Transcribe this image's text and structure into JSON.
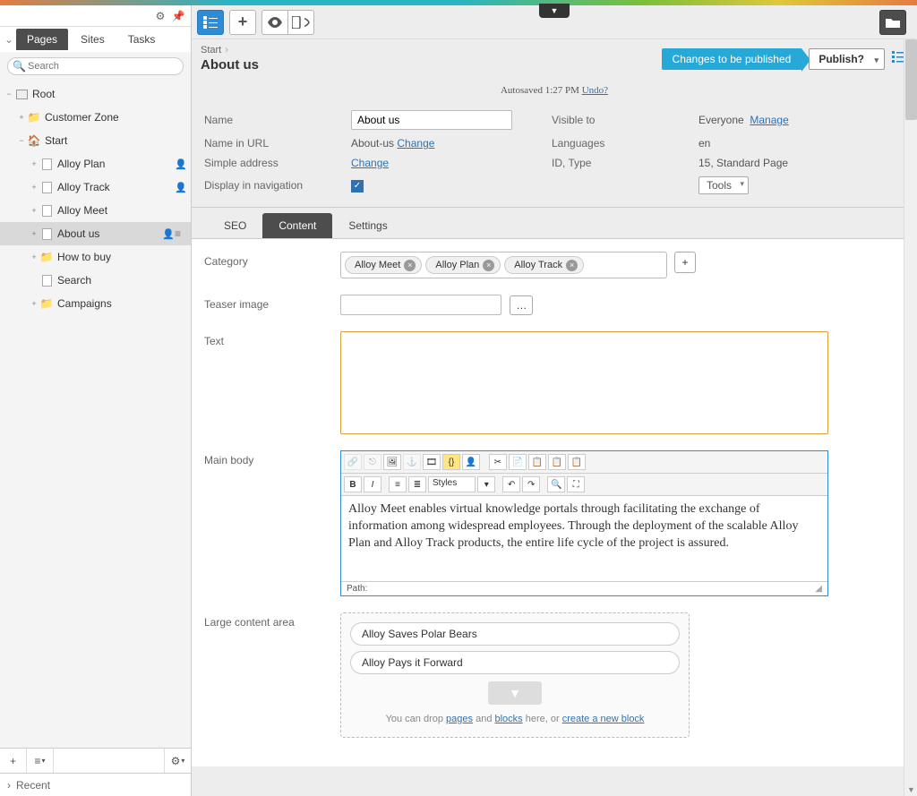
{
  "left": {
    "tabs": [
      "Pages",
      "Sites",
      "Tasks"
    ],
    "search_placeholder": "Search",
    "root": "Root",
    "nodes": [
      {
        "label": "Customer Zone",
        "depth": 1,
        "icon": "folder",
        "expand": "+"
      },
      {
        "label": "Start",
        "depth": 1,
        "icon": "home",
        "expand": "−"
      },
      {
        "label": "Alloy Plan",
        "depth": 2,
        "icon": "file",
        "expand": "+",
        "user": true
      },
      {
        "label": "Alloy Track",
        "depth": 2,
        "icon": "file",
        "expand": "+",
        "user": true
      },
      {
        "label": "Alloy Meet",
        "depth": 2,
        "icon": "file",
        "expand": "+"
      },
      {
        "label": "About us",
        "depth": 2,
        "icon": "file",
        "expand": "+",
        "selected": true,
        "user": true,
        "menu": true
      },
      {
        "label": "How to buy",
        "depth": 2,
        "icon": "folder",
        "expand": "+"
      },
      {
        "label": "Search",
        "depth": 2,
        "icon": "file",
        "expand": ""
      },
      {
        "label": "Campaigns",
        "depth": 2,
        "icon": "folder",
        "expand": "+"
      }
    ],
    "recent": "Recent"
  },
  "header": {
    "breadcrumb": "Start",
    "title": "About us",
    "status": "Changes to be published",
    "publish": "Publish?",
    "autosave_prefix": "Autosaved 1:27 PM",
    "undo": "Undo?"
  },
  "props": {
    "name_lbl": "Name",
    "name_val": "About us",
    "url_lbl": "Name in URL",
    "url_val": "About-us",
    "change": "Change",
    "simple_lbl": "Simple address",
    "nav_lbl": "Display in navigation",
    "visible_lbl": "Visible to",
    "visible_val": "Everyone",
    "manage": "Manage",
    "lang_lbl": "Languages",
    "lang_val": "en",
    "id_lbl": "ID, Type",
    "id_val": "15, Standard Page",
    "tools": "Tools"
  },
  "ctabs": [
    "SEO",
    "Content",
    "Settings"
  ],
  "form": {
    "category_lbl": "Category",
    "categories": [
      "Alloy Meet",
      "Alloy Plan",
      "Alloy Track"
    ],
    "teaser_lbl": "Teaser image",
    "text_lbl": "Text",
    "mainbody_lbl": "Main body",
    "editor_styles": "Styles",
    "editor_text": "Alloy Meet enables virtual knowledge portals through facilitating the exchange of information among widespread employees. Through the deployment of the scalable Alloy Plan and Alloy Track products, the entire life cycle of the project is assured.",
    "editor_path": "Path:",
    "large_lbl": "Large content area",
    "blocks": [
      "Alloy Saves Polar Bears",
      "Alloy Pays it Forward"
    ],
    "drop_prefix": "You can drop ",
    "drop_pages": "pages",
    "drop_and": " and ",
    "drop_blocks": "blocks",
    "drop_here": " here, or ",
    "drop_create": "create a new block"
  }
}
